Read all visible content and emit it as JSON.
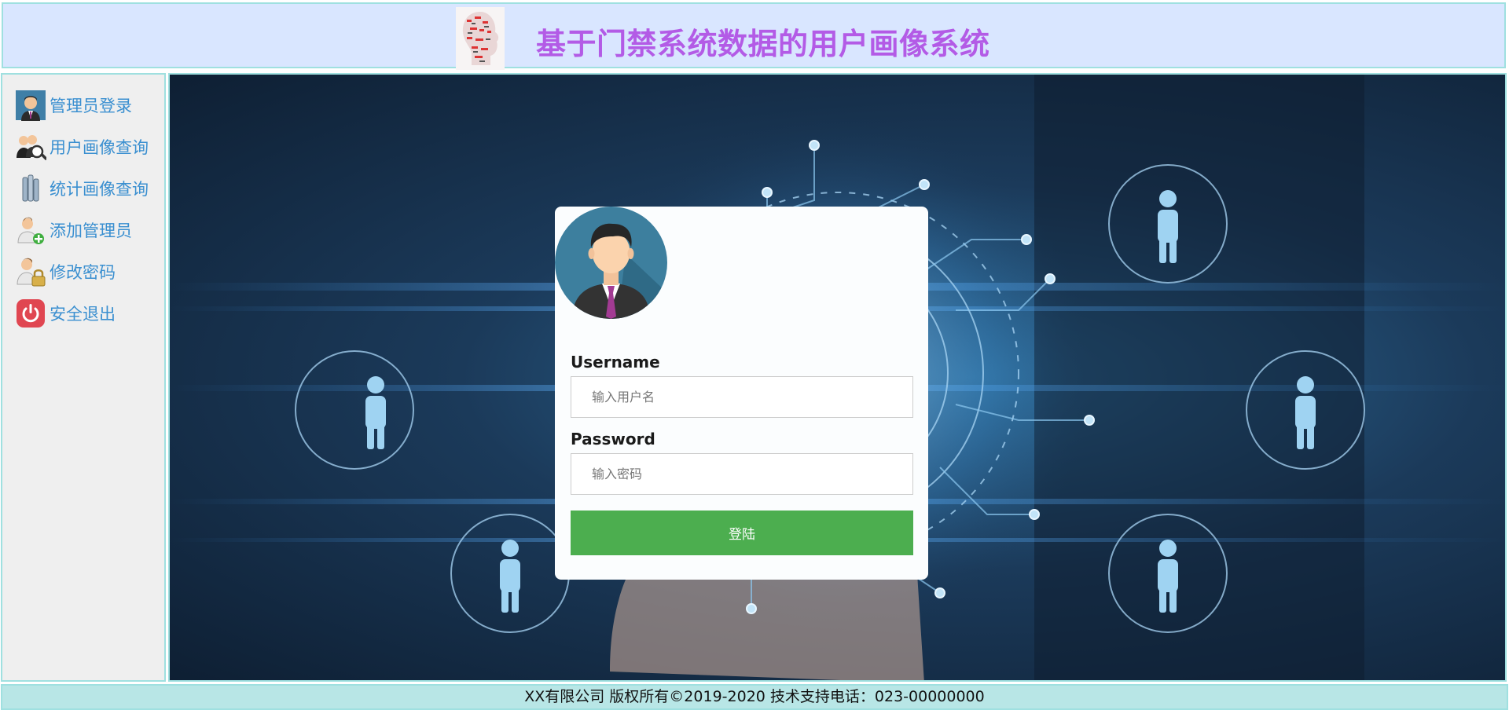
{
  "header": {
    "title": "基于门禁系统数据的用户画像系统",
    "title_color": "#b35be6"
  },
  "sidebar": {
    "items": [
      {
        "label": "管理员登录",
        "icon": "admin-avatar-icon"
      },
      {
        "label": "用户画像查询",
        "icon": "user-search-icon"
      },
      {
        "label": "统计画像查询",
        "icon": "statistics-icon"
      },
      {
        "label": "添加管理员",
        "icon": "add-user-icon"
      },
      {
        "label": "修改密码",
        "icon": "user-lock-icon"
      },
      {
        "label": "安全退出",
        "icon": "power-icon"
      }
    ],
    "link_color": "#3a8fd0"
  },
  "login": {
    "username_label": "Username",
    "username_placeholder": "输入用户名",
    "password_label": "Password",
    "password_placeholder": "输入密码",
    "submit_label": "登陆",
    "button_color": "#4cae4f"
  },
  "footer": {
    "text": "XX有限公司 版权所有©2019-2020 技术支持电话：023-00000000"
  }
}
